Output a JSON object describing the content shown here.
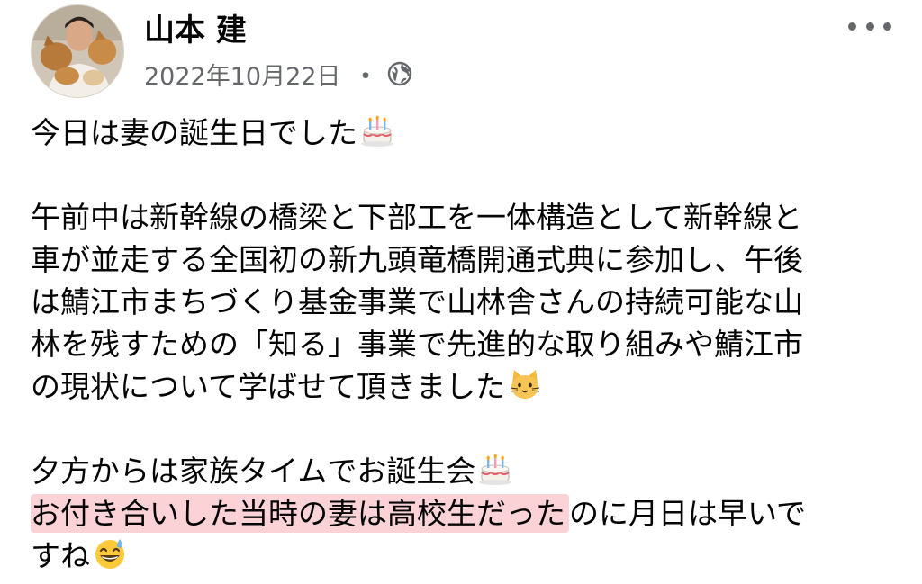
{
  "author": {
    "name": "山本 建",
    "avatar": "profile-photo"
  },
  "meta": {
    "date": "2022年10月22日",
    "separator": "・",
    "privacy_icon": "globe-icon"
  },
  "menu": {
    "icon": "more-dots-icon"
  },
  "post": {
    "lines": [
      "今日は妻の誕生日でした",
      "",
      "午前中は新幹線の橋梁と下部工を一体構造として新幹線と",
      "車が並走する全国初の新九頭竜橋開通式典に参加し、午後",
      "は鯖江市まちづくり基金事業で山林舎さんの持続可能な山",
      "林を残すための「知る」事業で先進的な取り組みや鯖江市",
      "の現状について学ばせて頂きました",
      "",
      "夕方からは家族タイムでお誕生会",
      "",
      "すね"
    ],
    "highlight_line": {
      "highlighted": "お付き合いした当時の妻は高校生だった",
      "rest": "のに月日は早いで"
    },
    "emojis": {
      "line1": "birthday-cake-icon",
      "line7": "cat-face-icon",
      "line9": "birthday-cake-icon",
      "line11": "grinning-sweat-icon"
    }
  },
  "colors": {
    "text": "#050505",
    "secondary": "#65676b",
    "highlight": "#fbd3d6"
  }
}
